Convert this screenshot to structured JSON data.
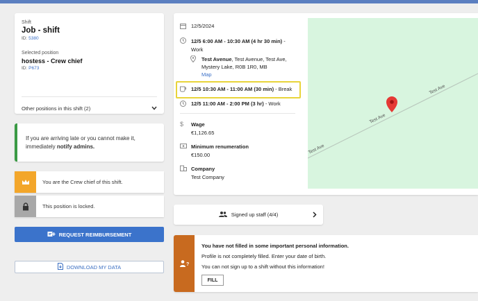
{
  "job": {
    "shift_label": "Shift",
    "title": "Job - shift",
    "id_label": "ID: ",
    "id_value": "5380",
    "position_label": "Selected position",
    "position_title": "hostess - Crew chief",
    "position_id_label": "ID: ",
    "position_id_value": "P673",
    "other_positions": "Other positions in this shift (2)"
  },
  "notice": {
    "text_before": "If you are arriving late or you cannot make it, immediately ",
    "text_bold": "notify admins."
  },
  "status_items": [
    {
      "text": "You are the Crew chief of this shift.",
      "icon": "crown-icon",
      "color": "#f3a62a"
    },
    {
      "text": "This position is locked.",
      "icon": "lock-icon",
      "color": "#a8a8a8"
    }
  ],
  "buttons": {
    "reimbursement": "REQUEST REIMBURSEMENT",
    "download": "DOWNLOAD MY DATA"
  },
  "details": {
    "date": "12/5/2024",
    "work1_time": "12/5 6:00 AM - 10:30 AM (4 hr 30 min)",
    "work1_suffix": " - Work",
    "location_bold": "Test Avenue",
    "location_rest": ", Test Avenue, Test Ave, Mystery Lake, R0B 1R0, MB",
    "map_link": "Map",
    "break_time": "12/5 10:30 AM - 11:00 AM (30 min)",
    "break_suffix": " - Break",
    "work2_time": "12/5 11:00 AM - 2:00 PM (3 hr)",
    "work2_suffix": " - Work",
    "wage_label": "Wage",
    "wage_value": "€1,126.65",
    "min_label": "Minimum renumeration",
    "min_value": "€150.00",
    "company_label": "Company",
    "company_value": "Test Company"
  },
  "map": {
    "road_label_1": "Test Ave",
    "road_label_2": "Test Ave",
    "road_label_3": "Test Ave",
    "marker_color": "#e53935"
  },
  "signed_up": "Signed up staff (4/4)",
  "info": {
    "title": "You have not filled in some important personal information.",
    "line1": "Profile is not completely filled. Enter your date of birth.",
    "line2": "You can not sign up to a shift without this information!",
    "fill_button": "FILL",
    "color": "#c86a1f"
  },
  "colors": {
    "accent": "#3b73cb",
    "success": "#3a9a44",
    "highlight": "#e8d43a"
  }
}
